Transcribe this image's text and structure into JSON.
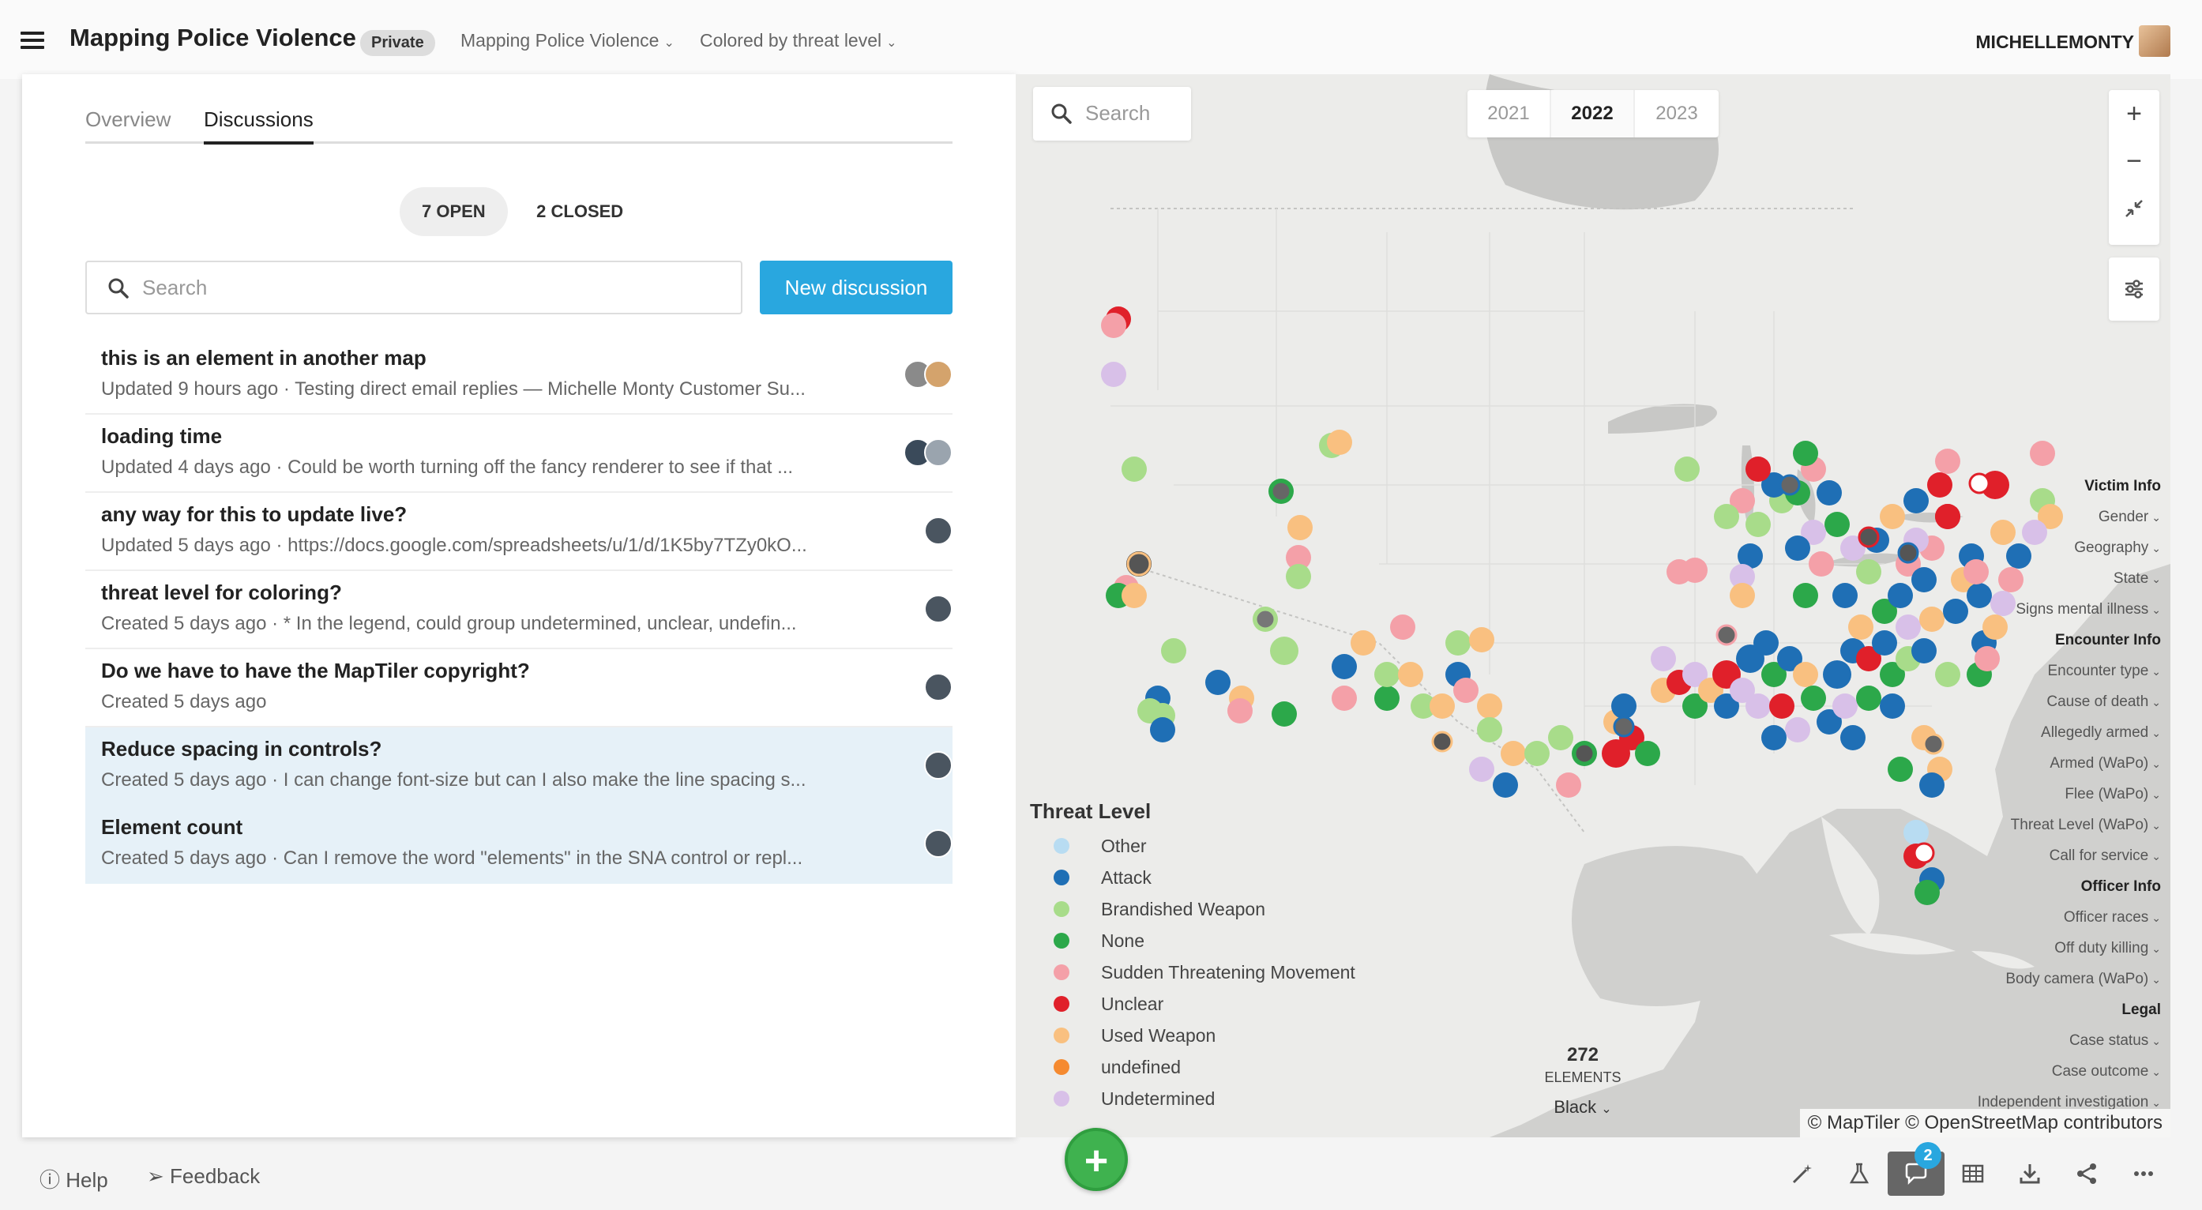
{
  "app": {
    "title": "Mapping Police Violence",
    "visibility": "Private",
    "map_selector": "Mapping Police Violence",
    "color_selector": "Colored by threat level",
    "username": "MICHELLEMONTY"
  },
  "panel": {
    "tabs": [
      {
        "label": "Overview"
      },
      {
        "label": "Discussions"
      }
    ],
    "filters": {
      "open": "7 OPEN",
      "closed": "2 CLOSED"
    },
    "search_placeholder": "Search",
    "new_discussion": "New discussion"
  },
  "discussions": [
    {
      "title": "this is an element in another map",
      "subtitle": "Updated 9 hours ago · Testing direct email replies — Michelle Monty Customer Su...",
      "avatars": [
        "#8a8a8a",
        "#d4a36c"
      ]
    },
    {
      "title": "loading time",
      "subtitle": "Updated 4 days ago · Could be worth turning off the fancy renderer to see if that ...",
      "avatars": [
        "#3a4a5a",
        "#9aa4ae"
      ]
    },
    {
      "title": "any way for this to update live?",
      "subtitle": "Updated 5 days ago · https://docs.google.com/spreadsheets/u/1/d/1K5by7TZy0kO...",
      "avatars": [
        "#4a5560"
      ]
    },
    {
      "title": "threat level for coloring?",
      "subtitle": "Created 5 days ago · * In the legend, could group undetermined, unclear, undefin...",
      "avatars": [
        "#4a5560"
      ]
    },
    {
      "title": "Do we have to have the MapTiler copyright?",
      "subtitle": "Created 5 days ago",
      "avatars": [
        "#4a5560"
      ]
    },
    {
      "title": "Reduce spacing in controls?",
      "subtitle": "Created 5 days ago · I can change font-size but can I also make the line spacing s...",
      "avatars": [
        "#4a5560"
      ]
    },
    {
      "title": "Element count",
      "subtitle": "Created 5 days ago · Can I remove the word \"elements\" in the SNA control or repl...",
      "avatars": [
        "#4a5560"
      ]
    }
  ],
  "map": {
    "search_placeholder": "Search",
    "years": [
      "2021",
      "2022",
      "2023"
    ],
    "zoom_in": "+",
    "zoom_out": "−",
    "legend": {
      "title": "Threat Level",
      "items": [
        {
          "label": "Other",
          "color": "#b8dcf2"
        },
        {
          "label": "Attack",
          "color": "#1f6fb5"
        },
        {
          "label": "Brandished Weapon",
          "color": "#a8dc8a"
        },
        {
          "label": "None",
          "color": "#2ca84a"
        },
        {
          "label": "Sudden Threatening Movement",
          "color": "#f4a0a8"
        },
        {
          "label": "Unclear",
          "color": "#e0202a"
        },
        {
          "label": "Used Weapon",
          "color": "#f9c080"
        },
        {
          "label": "undefined",
          "color": "#f58a30"
        },
        {
          "label": "Undetermined",
          "color": "#d8c0e8"
        }
      ]
    },
    "side_filters": [
      {
        "label": "Victim Info",
        "head": true
      },
      {
        "label": "Gender"
      },
      {
        "label": "Geography"
      },
      {
        "label": "State"
      },
      {
        "label": "Signs mental illness"
      },
      {
        "label": "Encounter Info",
        "head": true
      },
      {
        "label": "Encounter type"
      },
      {
        "label": "Cause of death"
      },
      {
        "label": "Allegedly armed"
      },
      {
        "label": "Armed (WaPo)"
      },
      {
        "label": "Flee (WaPo)"
      },
      {
        "label": "Threat Level (WaPo)"
      },
      {
        "label": "Call for service"
      },
      {
        "label": "Officer Info",
        "head": true
      },
      {
        "label": "Officer races"
      },
      {
        "label": "Off duty killing"
      },
      {
        "label": "Body camera (WaPo)"
      },
      {
        "label": "Legal",
        "head": true
      },
      {
        "label": "Case status"
      },
      {
        "label": "Case outcome"
      },
      {
        "label": "Independent investigation"
      }
    ],
    "element_count": "272",
    "element_label": "ELEMENTS",
    "color_mode": "Black",
    "copyright": "© MapTiler © OpenStreetMap contributors"
  },
  "bottom": {
    "help": "Help",
    "feedback": "Feedback",
    "fab": "+",
    "discussion_count": "2"
  }
}
